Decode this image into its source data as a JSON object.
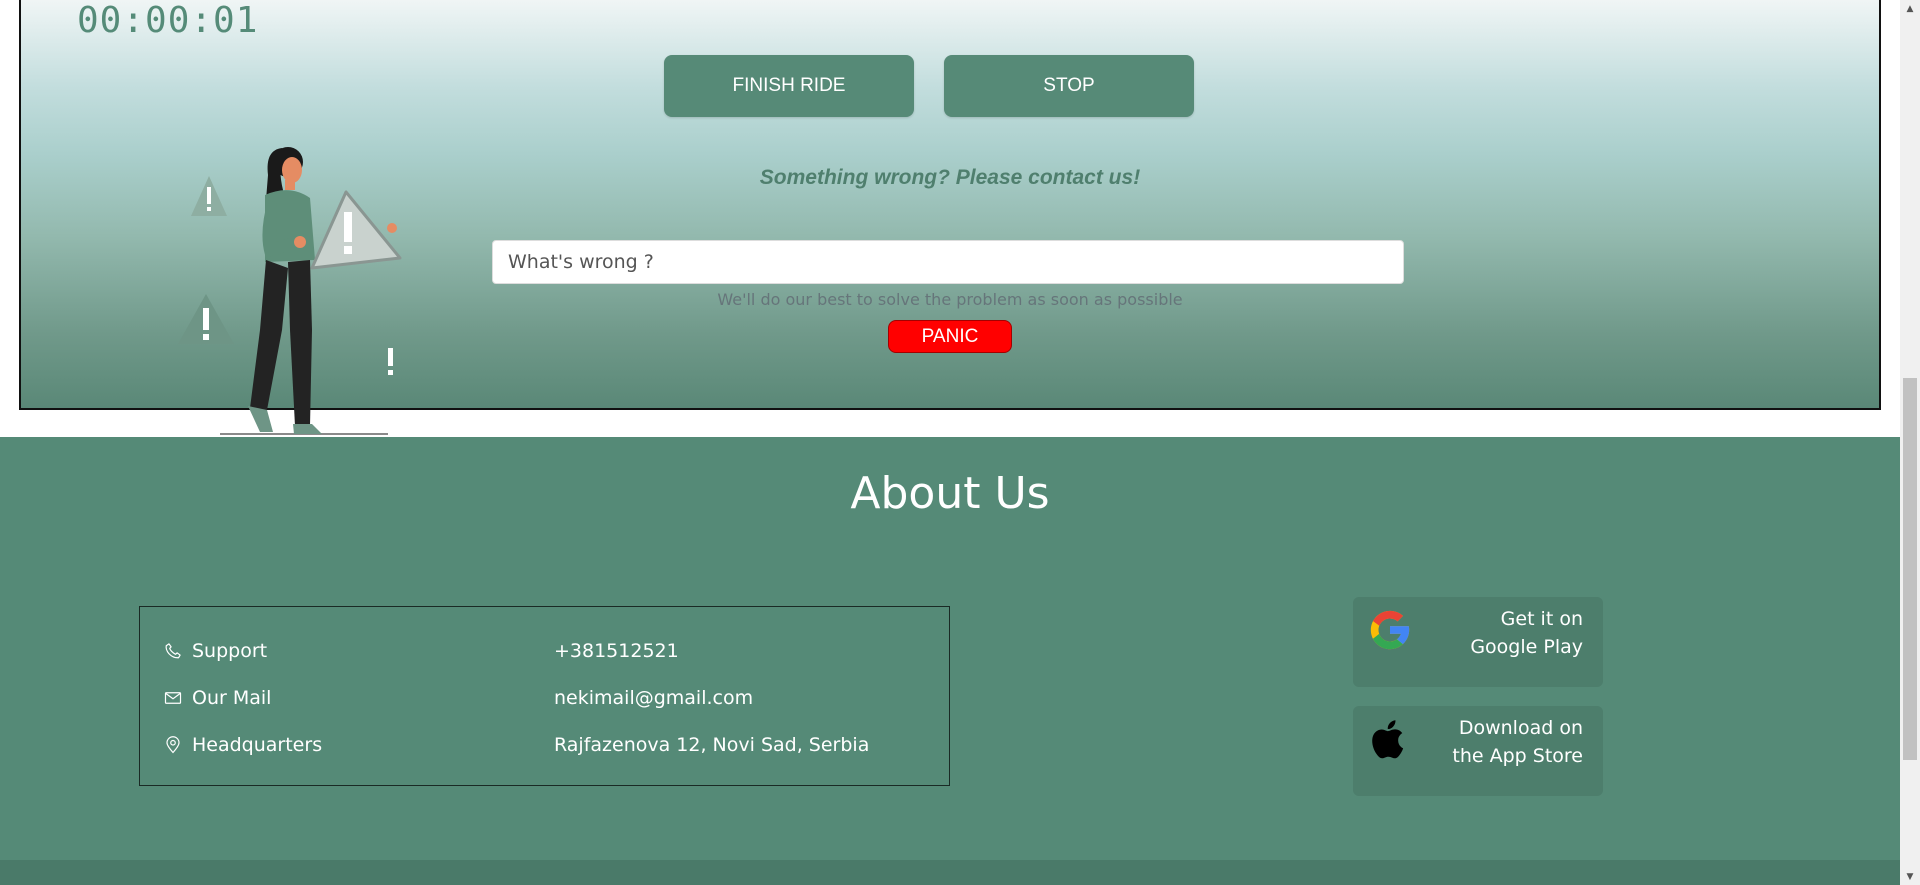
{
  "ride": {
    "timer": "00:00:01",
    "finish_label": "FINISH RIDE",
    "stop_label": "STOP",
    "contact_title": "Something wrong? Please contact us!",
    "issue_placeholder": "What's wrong ?",
    "helper_text": "We'll do our best to solve the problem as soon as possible",
    "panic_label": "PANIC"
  },
  "footer": {
    "title": "About Us",
    "contacts": [
      {
        "icon": "phone-icon",
        "label": "Support",
        "value": "+381512521"
      },
      {
        "icon": "mail-icon",
        "label": "Our Mail",
        "value": "nekimail@gmail.com"
      },
      {
        "icon": "location-pin-icon",
        "label": "Headquarters",
        "value": "Rajfazenova 12, Novi Sad, Serbia"
      }
    ],
    "stores": [
      {
        "icon": "google-icon",
        "line1": "Get it on",
        "line2": "Google Play"
      },
      {
        "icon": "apple-icon",
        "line1": "Download on",
        "line2": "the App Store"
      }
    ]
  },
  "colors": {
    "brand_green": "#558a77",
    "panic_red": "#ff0000",
    "footer_bg": "#558a77"
  }
}
